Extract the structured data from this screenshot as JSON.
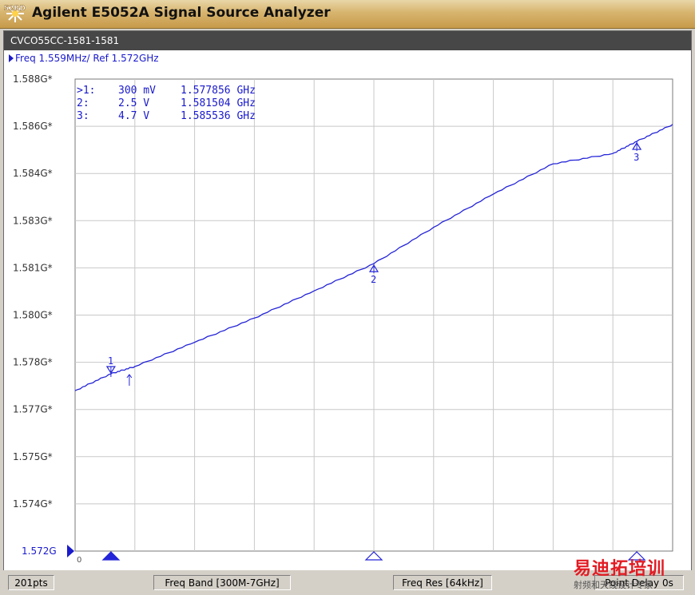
{
  "app": {
    "title": "Agilent E5052A Signal Source Analyzer",
    "icon_badge": "52RD",
    "window_title": "CVCO55CC-1581-1581",
    "trace_label": "Freq 1.559MHz/ Ref 1.572GHz"
  },
  "markers": [
    {
      "id": "1",
      "prefix": ">1:",
      "voltage": "300 mV",
      "freq": "1.577856 GHz",
      "x_fraction": 0.06
    },
    {
      "id": "2",
      "prefix": "2:",
      "voltage": "2.5 V",
      "freq": "1.581504 GHz",
      "x_fraction": 0.5
    },
    {
      "id": "3",
      "prefix": "3:",
      "voltage": "4.7 V",
      "freq": "1.585536 GHz",
      "x_fraction": 0.94
    }
  ],
  "chart_data": {
    "type": "line",
    "ylabels": [
      "1.588G*",
      "1.586G*",
      "1.584G*",
      "1.583G*",
      "1.581G*",
      "1.580G*",
      "1.578G*",
      "1.577G*",
      "1.575G*",
      "1.574G*"
    ],
    "ref_label": "1.572G",
    "x_start_label": "0",
    "ylim": [
      1.572,
      1.5876
    ],
    "xlim": [
      0,
      1
    ],
    "grid": true,
    "series": [
      {
        "x": [
          0,
          0.06,
          0.1,
          0.2,
          0.3,
          0.4,
          0.5,
          0.6,
          0.7,
          0.8,
          0.9,
          0.94,
          1.0
        ],
        "y": [
          1.5773,
          1.57786,
          1.5781,
          1.5789,
          1.5797,
          1.5806,
          1.5815,
          1.5827,
          1.5838,
          1.5848,
          1.58514,
          1.58554,
          1.5861
        ]
      }
    ],
    "color": "#2424d8"
  },
  "status": {
    "points": "201pts",
    "freq_band": "Freq Band [300M-7GHz]",
    "freq_res": "Freq Res [64kHz]",
    "point_delay": "Point Delay 0s"
  },
  "watermark": {
    "line1": "易迪拓培训",
    "line2": "射频和天线设计专家"
  }
}
